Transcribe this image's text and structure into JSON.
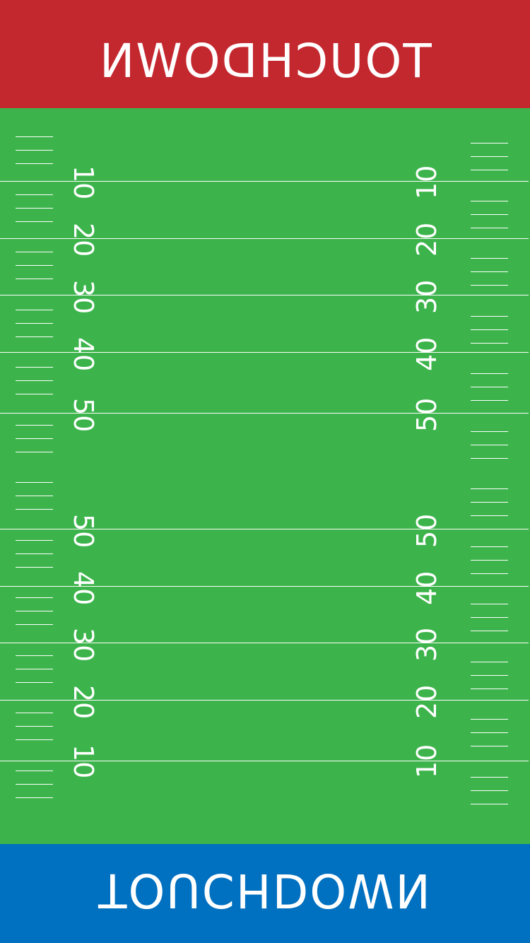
{
  "colors": {
    "field": "#3cb44b",
    "home_endzone": "#c4282f",
    "away_endzone": "#0070c0",
    "markings": "#ffffff"
  },
  "endzones": {
    "top_label": "TOUCHDOWN",
    "bottom_label": "TOUCHDOWN"
  },
  "yard_numbers": {
    "top_half": [
      "10",
      "20",
      "30",
      "40",
      "50"
    ],
    "bottom_half": [
      "50",
      "40",
      "30",
      "20",
      "10"
    ]
  }
}
